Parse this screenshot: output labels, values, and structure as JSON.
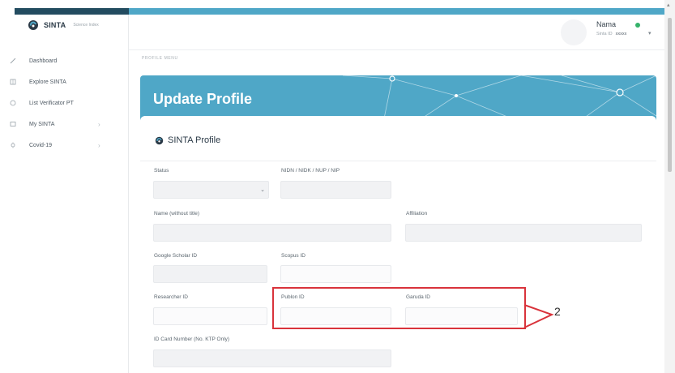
{
  "brand": {
    "name": "SINTA",
    "tagline": "Science Index"
  },
  "sidebar": {
    "items": [
      {
        "label": "Dashboard",
        "icon": "pencil-icon",
        "has_chevron": false
      },
      {
        "label": "Explore SINTA",
        "icon": "book-icon",
        "has_chevron": false
      },
      {
        "label": "List Verificator PT",
        "icon": "badge-icon",
        "has_chevron": false
      },
      {
        "label": "My SINTA",
        "icon": "list-icon",
        "has_chevron": true
      },
      {
        "label": "Covid-19",
        "icon": "virus-icon",
        "has_chevron": true
      }
    ]
  },
  "header": {
    "user_name": "Nama",
    "user_id_label": "Sinta ID",
    "user_id_value": "xxxxx",
    "status_color": "#35b26a"
  },
  "breadcrumb": "PROFILE MENU",
  "banner": {
    "title": "Update Profile",
    "color": "#4fa7c7"
  },
  "card": {
    "title": "SINTA Profile"
  },
  "form": {
    "status_label": "Status",
    "nidn_label": "NIDN / NIDK / NUP / NIP",
    "name_label": "Name (without title)",
    "affiliation_label": "Affiliation",
    "google_label": "Google Scholar ID",
    "scopus_label": "Scopus ID",
    "researcher_label": "Researcher ID",
    "publon_label": "Publon ID",
    "garuda_label": "Garuda ID",
    "idcard_label": "ID Card Number (No. KTP Only)"
  },
  "annotation": {
    "number": "2",
    "color": "#d9333b"
  }
}
